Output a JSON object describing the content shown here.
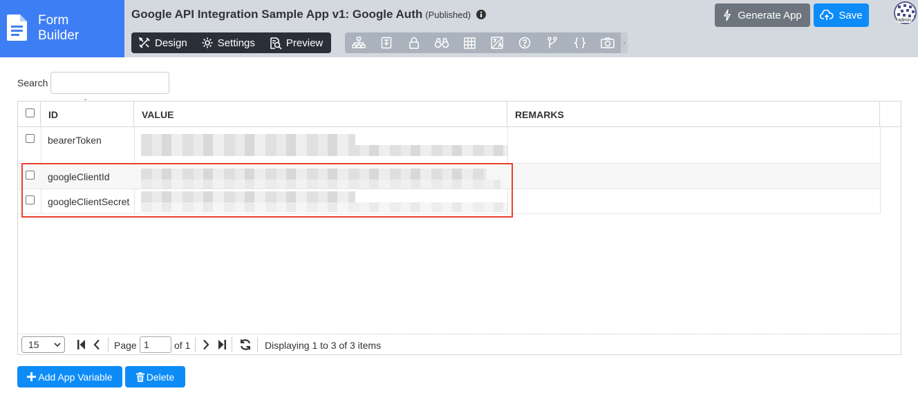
{
  "brand": {
    "line1": "Form",
    "line2": "Builder"
  },
  "app": {
    "title": "Google API Integration Sample App v1: Google Auth",
    "status": "(Published)"
  },
  "modes": [
    {
      "label": "Design",
      "icon": "design-tools-icon"
    },
    {
      "label": "Settings",
      "icon": "gear-icon"
    },
    {
      "label": "Preview",
      "icon": "preview-search-icon"
    }
  ],
  "toolbar": {
    "icons": [
      "sitemap-icon",
      "resource-bundle-icon",
      "lock-icon",
      "binoculars-icon",
      "grid-table-icon",
      "translate-icon",
      "help-circle-icon",
      "branch-icon",
      "curly-braces-icon",
      "camera-icon"
    ]
  },
  "actions": {
    "generate_label": "Generate App",
    "save_label": "Save"
  },
  "user": {
    "avatar_label": "admin"
  },
  "search": {
    "label": "Search",
    "value": ""
  },
  "grid": {
    "columns": [
      "ID",
      "VALUE",
      "REMARKS"
    ],
    "rows": [
      {
        "id": "bearerToken",
        "value": "",
        "remarks": ""
      },
      {
        "id": "googleClientId",
        "value": "",
        "remarks": ""
      },
      {
        "id": "googleClientSecret",
        "value": "",
        "remarks": ""
      }
    ]
  },
  "pager": {
    "page_size": "15",
    "page_label": "Page",
    "page_value": "1",
    "of_label": "of 1",
    "status": "Displaying 1 to 3 of 3 items"
  },
  "buttons": {
    "add_label": "Add App Variable",
    "delete_label": "Delete"
  },
  "colors": {
    "brand": "#3e7ef5",
    "primary": "#0d8cf8",
    "highlight": "#e8402e",
    "header_bg": "#d4d9e0"
  }
}
